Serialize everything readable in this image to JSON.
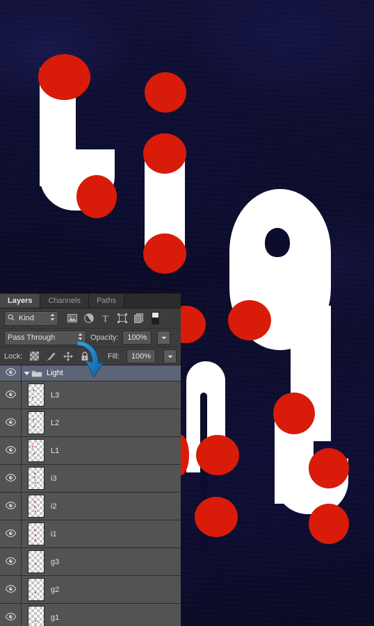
{
  "canvas": {
    "artwork_text": "Light",
    "background_color": "#0c0c2c",
    "letter_color": "#ffffff",
    "dot_color": "#d81c09"
  },
  "panel": {
    "tabs": [
      {
        "label": "Layers",
        "active": true
      },
      {
        "label": "Channels",
        "active": false
      },
      {
        "label": "Paths",
        "active": false
      }
    ],
    "filter": {
      "kind_label": "Kind",
      "search_icon": "search-icon",
      "stepper_icon": "updown-stepper-icon",
      "icons": [
        "pixel-layer-filter-icon",
        "adjustment-layer-filter-icon",
        "type-layer-filter-icon",
        "shape-layer-filter-icon",
        "smart-object-filter-icon"
      ],
      "type_glyph": "T",
      "toggle_icon": "filter-toggle-icon"
    },
    "blend": {
      "mode": "Pass Through",
      "opacity_label": "Opacity:",
      "opacity_value": "100%",
      "fill_label": "Fill:",
      "fill_value": "100%",
      "stepper_icon": "updown-stepper-icon",
      "dropdown_icon": "chevron-down-icon"
    },
    "lock": {
      "label": "Lock:",
      "icons": [
        "lock-transparency-icon",
        "lock-image-icon",
        "lock-position-icon",
        "lock-all-icon"
      ]
    },
    "layers": [
      {
        "name": "Light",
        "type": "group",
        "visible": true,
        "selected": true,
        "expanded": true
      },
      {
        "name": "L3",
        "type": "layer",
        "visible": true,
        "selected": false
      },
      {
        "name": "L2",
        "type": "layer",
        "visible": true,
        "selected": false
      },
      {
        "name": "L1",
        "type": "layer",
        "visible": true,
        "selected": false
      },
      {
        "name": "i3",
        "type": "layer",
        "visible": true,
        "selected": false
      },
      {
        "name": "i2",
        "type": "layer",
        "visible": true,
        "selected": false
      },
      {
        "name": "i1",
        "type": "layer",
        "visible": true,
        "selected": false
      },
      {
        "name": "g3",
        "type": "layer",
        "visible": true,
        "selected": false
      },
      {
        "name": "g2",
        "type": "layer",
        "visible": true,
        "selected": false
      },
      {
        "name": "g1",
        "type": "layer",
        "visible": true,
        "selected": false
      }
    ],
    "selected_row_color": "#5b6576",
    "row_color": "#535353",
    "panel_bg": "#3d3d3d"
  },
  "annotation": {
    "arrow": "curved-down-arrow-annotation",
    "color": "#1f7ec4"
  }
}
